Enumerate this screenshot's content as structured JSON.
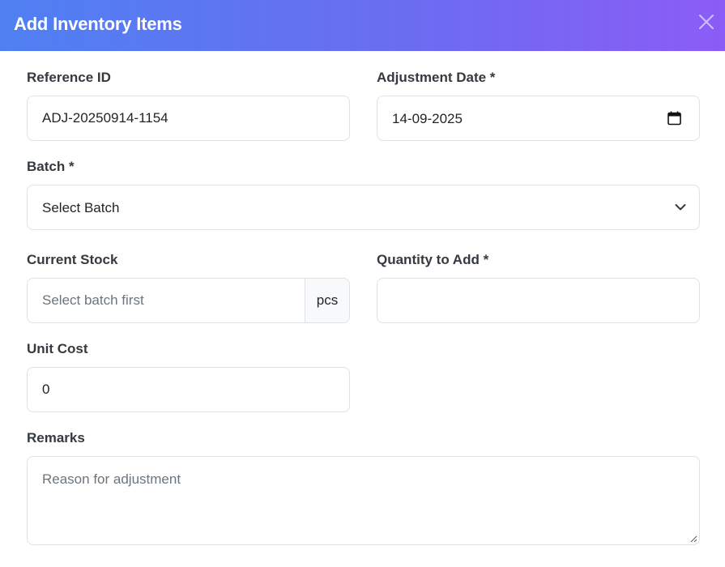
{
  "modal": {
    "title": "Add Inventory Items"
  },
  "form": {
    "reference_id": {
      "label": "Reference ID",
      "value": "ADJ-20250914-1154"
    },
    "adjustment_date": {
      "label": "Adjustment Date *",
      "value": "14-09-2025"
    },
    "batch": {
      "label": "Batch *",
      "selected": "Select Batch"
    },
    "current_stock": {
      "label": "Current Stock",
      "placeholder": "Select batch first",
      "unit": "pcs"
    },
    "quantity_to_add": {
      "label": "Quantity to Add *",
      "value": ""
    },
    "unit_cost": {
      "label": "Unit Cost",
      "value": "0"
    },
    "remarks": {
      "label": "Remarks",
      "placeholder": "Reason for adjustment"
    }
  },
  "icons": {
    "close": "close-icon",
    "calendar": "calendar-icon",
    "dropdown": "chevron-down-icon"
  },
  "colors": {
    "header_gradient_start": "#4f80f2",
    "header_gradient_end": "#8b5cf6"
  }
}
